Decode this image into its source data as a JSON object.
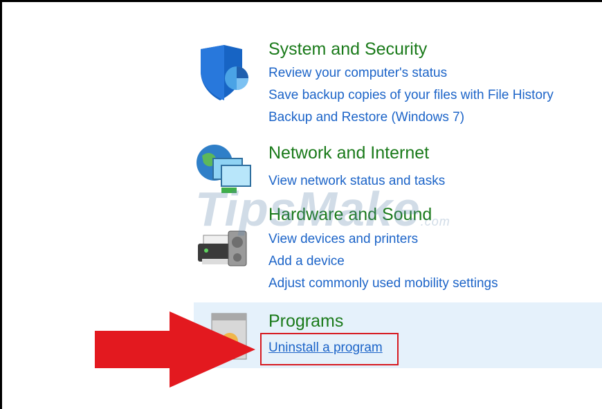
{
  "categories": {
    "system_security": {
      "title": "System and Security",
      "links": [
        "Review your computer's status",
        "Save backup copies of your files with File History",
        "Backup and Restore (Windows 7)"
      ]
    },
    "network_internet": {
      "title": "Network and Internet",
      "links": [
        "View network status and tasks"
      ]
    },
    "hardware_sound": {
      "title": "Hardware and Sound",
      "links": [
        "View devices and printers",
        "Add a device",
        "Adjust commonly used mobility settings"
      ]
    },
    "programs": {
      "title": "Programs",
      "links": [
        "Uninstall a program"
      ]
    }
  },
  "watermark": {
    "text": "TipsMake",
    "suffix": ".com"
  },
  "colors": {
    "title": "#1a7a1a",
    "link": "#1c64c8",
    "highlight_bg": "#e5f1fb",
    "annotation_red": "#e3191f"
  },
  "icons": [
    "shield-icon",
    "network-globe-icon",
    "printer-icon",
    "programs-icon",
    "red-arrow-icon"
  ]
}
